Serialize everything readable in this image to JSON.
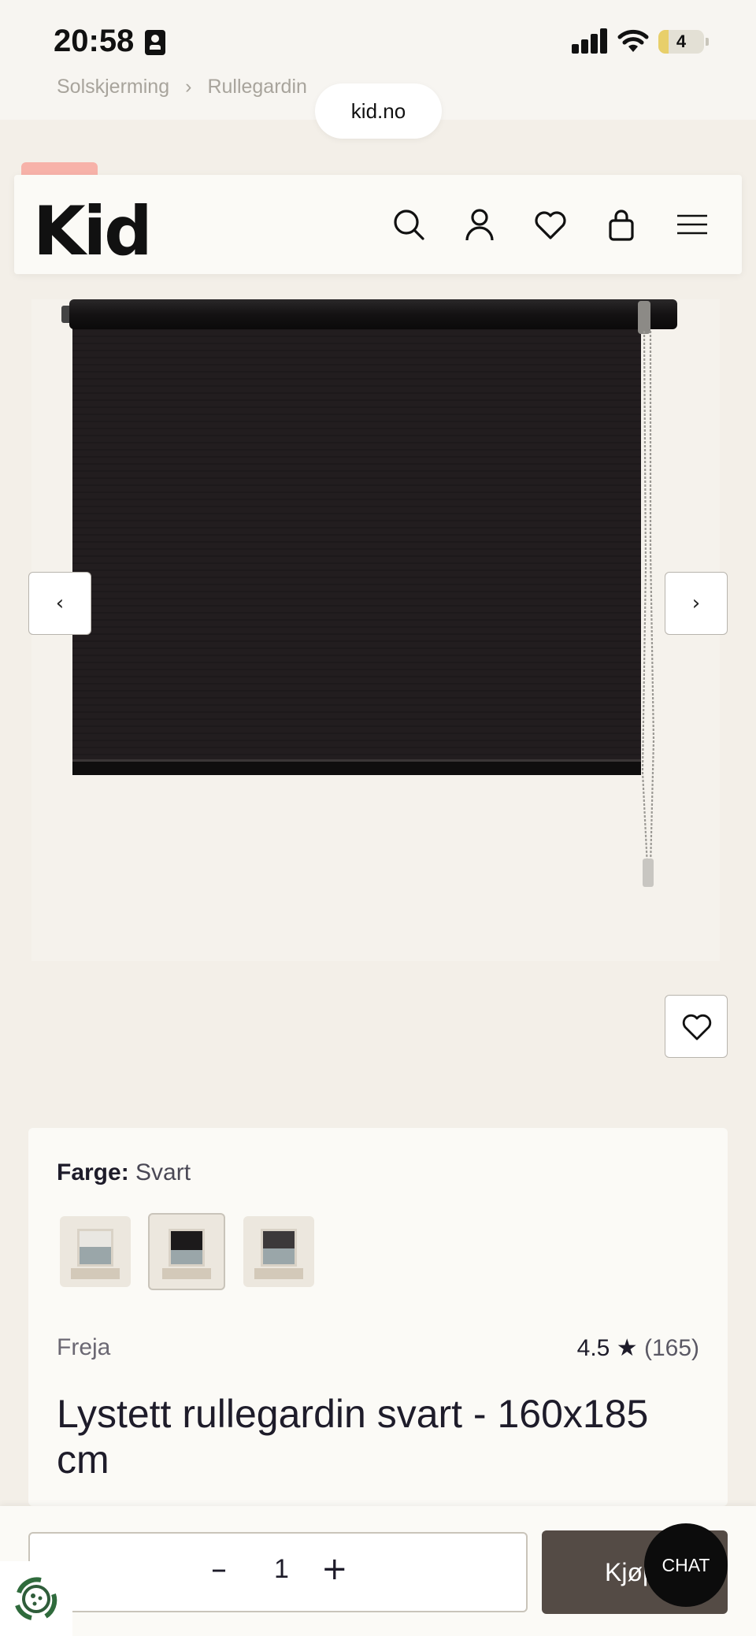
{
  "status_bar": {
    "time": "20:58",
    "battery": "4"
  },
  "breadcrumb": {
    "items": [
      "Solskjerming",
      "Rullegardin"
    ],
    "separator": "›"
  },
  "browser": {
    "url": "kid.no"
  },
  "header": {
    "logo": "Kid",
    "icons": [
      "search-icon",
      "account-icon",
      "wishlist-icon",
      "bag-icon",
      "menu-icon"
    ]
  },
  "gallery": {
    "prev_label": "‹",
    "next_label": "›"
  },
  "product": {
    "color_label": "Farge:",
    "color_value": "Svart",
    "swatches": [
      {
        "name": "Hvit",
        "shade": "#e9e7e2"
      },
      {
        "name": "Svart",
        "shade": "#1c1a1b",
        "selected": true
      },
      {
        "name": "Grå",
        "shade": "#3c393a"
      }
    ],
    "brand": "Freja",
    "rating": "4.5",
    "rating_star": "★",
    "review_count": "(165)",
    "title": "Lystett rullegardin svart - 160x185 cm"
  },
  "buy_bar": {
    "quantity": "1",
    "minus": "–",
    "plus": "+",
    "buy_label": "Kjøp"
  },
  "chat": {
    "label": "CHAT"
  },
  "colors": {
    "page_bg": "#f3efe8",
    "accent_buy": "#544b45",
    "sale_tab": "#f7b2a9"
  }
}
